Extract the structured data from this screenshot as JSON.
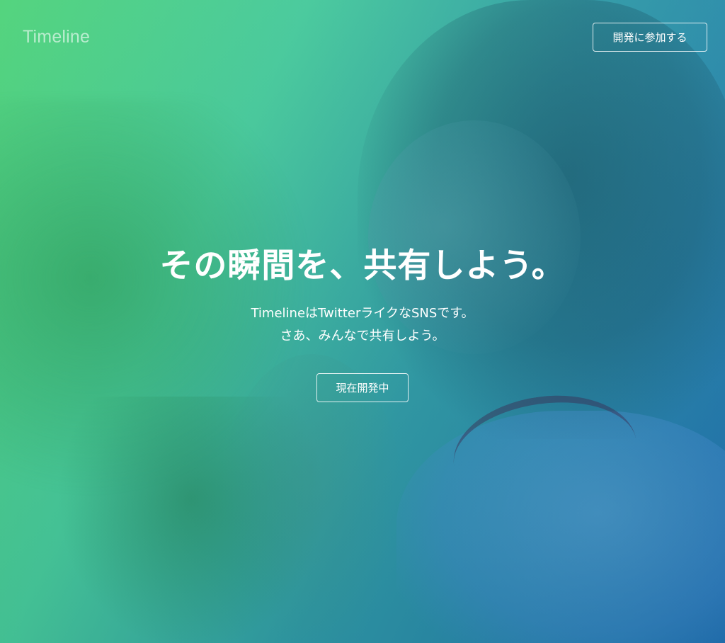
{
  "header": {
    "brand": "Timeline",
    "join_button_label": "開発に参加する"
  },
  "hero": {
    "headline": "その瞬間を、共有しよう。",
    "subtext_line1": "TimelineはTwitterライクなSNSです。",
    "subtext_line2": "さあ、みんなで共有しよう。",
    "status_button_label": "現在開発中"
  },
  "colors": {
    "gradient_start": "#4fd37a",
    "gradient_end": "#1f6fb0",
    "text": "#ffffff"
  }
}
